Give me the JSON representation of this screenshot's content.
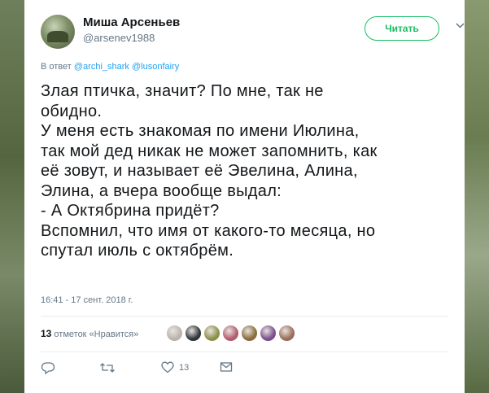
{
  "tweet": {
    "display_name": "Миша Арсеньев",
    "handle": "@arsenev1988",
    "follow_label": "Читать",
    "reply_prefix": "В ответ",
    "reply_mentions": [
      "@archi_shark",
      "@lusonfairy"
    ],
    "text": "Злая птичка, значит? По мне, так не\nобидно.\nУ меня есть знакомая по имени Июлина,\nтак мой дед никак не может запомнить, как\nеё зовут, и называет её Эвелина, Алина,\nЭлина, а вчера вообще выдал:\n- А Октябрина придёт?\nВспомнил, что имя от какого-то месяца, но\nспутал июль с октябрём.",
    "timestamp": "16:41 - 17 сент. 2018 г.",
    "likes_count": "13",
    "likes_label": "отметок «Нравится»",
    "like_action_count": "13"
  },
  "icons": {
    "chevron": "chevron-down-icon",
    "reply": "reply-icon",
    "retweet": "retweet-icon",
    "like": "heart-icon",
    "dm": "envelope-icon"
  },
  "colors": {
    "accent_green": "#17bf63",
    "link_blue": "#1da1f2",
    "muted": "#657786",
    "text": "#14171a"
  },
  "likers": [
    {
      "color": "#b9b3ae"
    },
    {
      "color": "#2f3438"
    },
    {
      "color": "#8c8f4a"
    },
    {
      "color": "#b25a6e"
    },
    {
      "color": "#8a6a3c"
    },
    {
      "color": "#7a4e8c"
    },
    {
      "color": "#9a6c58"
    }
  ]
}
